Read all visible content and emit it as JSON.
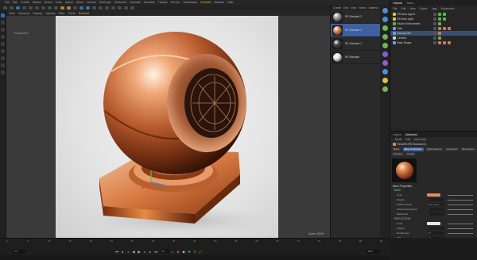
{
  "menubar": {
    "items": [
      {
        "label": "File"
      },
      {
        "label": "Edit"
      },
      {
        "label": "Create"
      },
      {
        "label": "Modes"
      },
      {
        "label": "Select"
      },
      {
        "label": "Tools"
      },
      {
        "label": "Spline"
      },
      {
        "label": "Mesh"
      },
      {
        "label": "Volume"
      },
      {
        "label": "MoGraph"
      },
      {
        "label": "Character"
      },
      {
        "label": "Animate"
      },
      {
        "label": "Simulate"
      },
      {
        "label": "Tracker"
      },
      {
        "label": "Render"
      },
      {
        "label": "Extensions"
      },
      {
        "label": "Redshift"
      },
      {
        "label": "Window"
      },
      {
        "label": "Help"
      }
    ],
    "highlight_index": 16,
    "active_index": 14
  },
  "viewport": {
    "menu": [
      {
        "label": "View"
      },
      {
        "label": "Cameras"
      },
      {
        "label": "Display"
      },
      {
        "label": "Options"
      },
      {
        "label": "Filter"
      },
      {
        "label": "Panel"
      },
      {
        "label": "Redshift"
      }
    ],
    "active_menu_index": 6,
    "title": "Perspective",
    "resolution": "Zoom: 100%",
    "render_colors": {
      "copper_light": "#f2b88a",
      "copper_mid": "#c86a36",
      "copper_dark": "#5a2410"
    }
  },
  "material_manager": {
    "title": "Create",
    "menu": [
      {
        "label": "Create"
      },
      {
        "label": "Edit"
      },
      {
        "label": "View"
      },
      {
        "label": "Select"
      },
      {
        "label": "Material"
      },
      {
        "label": "Texture"
      }
    ],
    "materials": [
      {
        "name": "RS Standard.3",
        "color": "#9a9a9a",
        "selected": false
      },
      {
        "name": "RS Standard.2",
        "color": "#d9894a",
        "selected": true
      },
      {
        "name": "RS Standard.1",
        "color": "#444444",
        "selected": false
      },
      {
        "name": "RS Standard",
        "color": "#e8e8e8",
        "selected": false
      }
    ]
  },
  "object_manager": {
    "tabs": [
      {
        "label": "Objects"
      },
      {
        "label": "Takes"
      }
    ],
    "menu": [
      {
        "label": "File"
      },
      {
        "label": "Edit"
      },
      {
        "label": "View"
      },
      {
        "label": "Object"
      },
      {
        "label": "Tags"
      },
      {
        "label": "Bookmarks"
      }
    ],
    "objects": [
      {
        "name": "RS Area Light.1",
        "icon_color": "#e8c04a",
        "tags": [
          "g",
          "g"
        ],
        "selected": false
      },
      {
        "name": "RS Area Light",
        "icon_color": "#e8c04a",
        "tags": [
          "g",
          "g"
        ],
        "selected": false
      },
      {
        "name": "Studio Environment",
        "icon_color": "#58b648",
        "tags": [
          "g"
        ],
        "selected": false
      },
      {
        "name": "Disk",
        "icon_color": "#6aa0e0",
        "tags": [
          "m",
          "m",
          "m"
        ],
        "selected": false
      },
      {
        "name": "Background",
        "icon_color": "#6aa0e0",
        "tags": [
          "m"
        ],
        "selected": true
      },
      {
        "name": "Camera",
        "icon_color": "#cfcfcf",
        "tags": [
          "g"
        ],
        "selected": false
      },
      {
        "name": "Base Shape",
        "icon_color": "#6aa0e0",
        "tags": [
          "m",
          "m",
          "m"
        ],
        "selected": false
      }
    ]
  },
  "attribute_manager": {
    "tabs": [
      {
        "label": "Layers"
      },
      {
        "label": "Attributes"
      }
    ],
    "menu": [
      {
        "label": "Mode"
      },
      {
        "label": "Edit"
      },
      {
        "label": "User Data"
      }
    ],
    "header": "Redshift (RS Standard.2)",
    "pills_row1": [
      {
        "label": "Basic"
      },
      {
        "label": "Base Properties"
      },
      {
        "label": "Optimizations"
      },
      {
        "label": "Advanced"
      },
      {
        "label": "Illumination"
      }
    ],
    "pills_row2": [
      {
        "label": "Preview"
      },
      {
        "label": "Nodes"
      }
    ],
    "active_pill": "Base Properties",
    "section_title": "Base Properties",
    "base": {
      "title": "BASE",
      "props": [
        {
          "label": "Color",
          "swatch": "#e08c5a"
        },
        {
          "label": "Weight",
          "value": "1"
        },
        {
          "label": "Diffuse Model",
          "value": "Oren-Nayar"
        },
        {
          "label": "Diffuse Roughness",
          "value": "0"
        },
        {
          "label": "Metalness",
          "value": "1"
        }
      ]
    },
    "reflection": {
      "title": "REFLECTION",
      "props": [
        {
          "label": "Color",
          "swatch": "#e6e6e6"
        },
        {
          "label": "Weight",
          "value": "1"
        },
        {
          "label": "Roughness",
          "value": "0.2"
        },
        {
          "label": "IOR",
          "value": "1.5"
        }
      ]
    }
  },
  "timeline": {
    "ticks": [
      "0",
      "5",
      "10",
      "15",
      "20",
      "25",
      "30",
      "35",
      "40",
      "45",
      "50",
      "55",
      "60",
      "65",
      "70",
      "75",
      "80",
      "85",
      "90"
    ],
    "start": "0 F",
    "end": "90 F",
    "current_frame": "0 F"
  }
}
